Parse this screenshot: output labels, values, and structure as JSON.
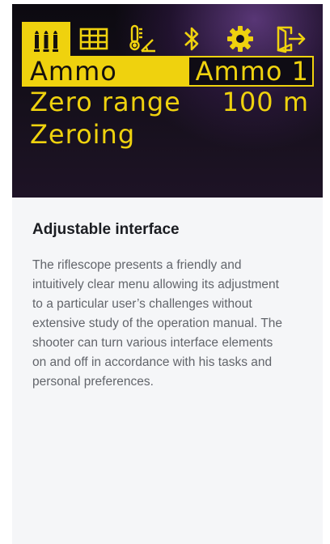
{
  "screen": {
    "tabs": [
      {
        "icon": "ammo-icon",
        "active": true
      },
      {
        "icon": "grid-icon",
        "active": false
      },
      {
        "icon": "thermometer-angle-icon",
        "active": false
      },
      {
        "icon": "bluetooth-icon",
        "active": false
      },
      {
        "icon": "gear-icon",
        "active": false
      },
      {
        "icon": "exit-icon",
        "active": false
      }
    ],
    "menu": [
      {
        "label": "Ammo",
        "value": "Ammo 1",
        "selected": true
      },
      {
        "label": "Zero range",
        "value": "100 m",
        "selected": false
      },
      {
        "label": "Zeroing",
        "value": "",
        "selected": false
      }
    ],
    "accent_color": "#efd20e"
  },
  "content": {
    "heading": "Adjustable interface",
    "body": "The riflescope presents a friendly and intuitively clear menu allowing its adjustment to a particular user’s challenges without extensive study of the operation manual. The shooter can turn various interface elements on and off in accordance with his tasks and personal preferences."
  }
}
